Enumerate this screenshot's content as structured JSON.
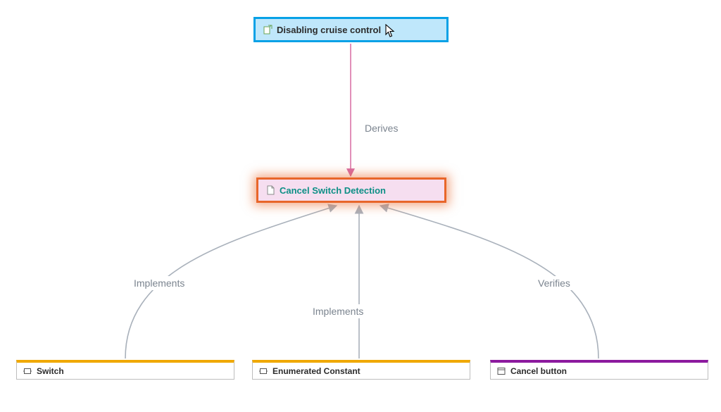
{
  "nodes": {
    "top": {
      "label": "Disabling cruise control"
    },
    "mid": {
      "label": "Cancel Switch Detection"
    },
    "bot1": {
      "label": "Switch"
    },
    "bot2": {
      "label": "Enumerated Constant"
    },
    "bot3": {
      "label": "Cancel button"
    }
  },
  "edges": {
    "derives": {
      "label": "Derives"
    },
    "implements1": {
      "label": "Implements"
    },
    "implements2": {
      "label": "Implements"
    },
    "verifies": {
      "label": "Verifies"
    }
  },
  "colors": {
    "top_fill": "#bfe7fb",
    "top_border": "#06a1e6",
    "mid_fill": "#f6def0",
    "mid_border": "#e8662a",
    "mid_text": "#0d8f86",
    "bot_orange": "#f0a800",
    "bot_purple": "#8c1a9e",
    "edge_gray": "#a9b1bb",
    "edge_pink": "#d76aa2",
    "label_gray": "#7b848f"
  }
}
